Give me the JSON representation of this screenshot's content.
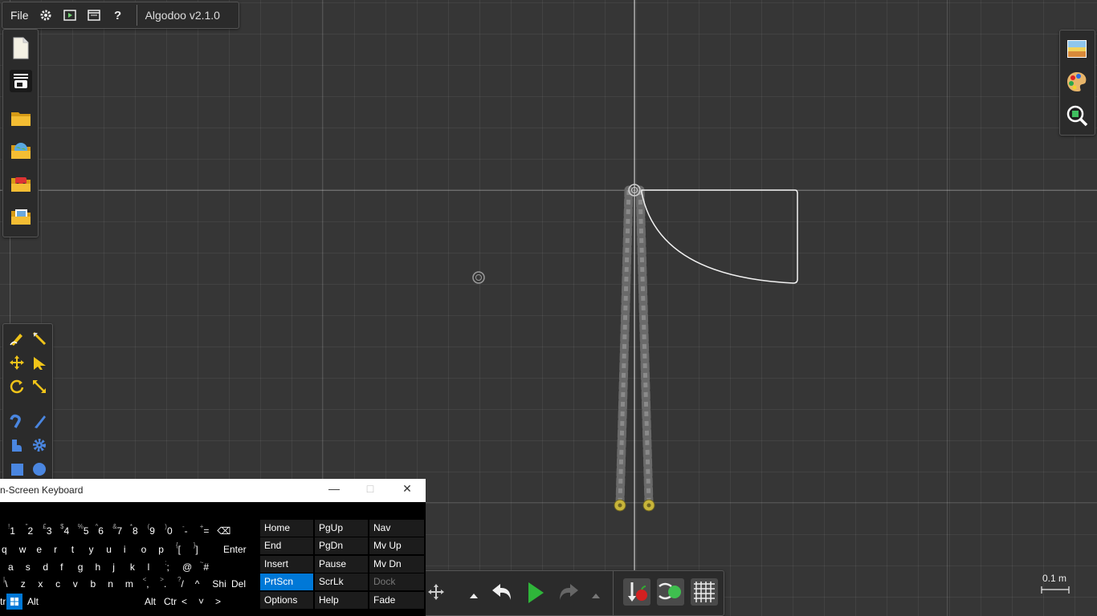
{
  "app": {
    "version": "Algodoo v2.1.0",
    "menu": {
      "file": "File"
    },
    "top_icons": [
      "settings-icon",
      "play-scene-icon",
      "window-icon",
      "help-icon"
    ]
  },
  "file_bar": [
    "new-scene-icon",
    "scene-list-icon",
    "open-folder-icon",
    "open-globe-icon",
    "open-phunlets-icon",
    "open-gallery-icon"
  ],
  "right_bar": [
    "background-icon",
    "palette-icon",
    "zoom-search-icon"
  ],
  "tools": [
    "sketch-tool-icon",
    "cut-tool-icon",
    "move-tool-icon",
    "drag-tool-icon",
    "rotate-tool-icon",
    "scale-tool-icon",
    "rope-tool-icon",
    "knife-tool-icon",
    "polygon-tool-icon",
    "gear-tool-icon",
    "box-tool-icon",
    "circle-tool-icon"
  ],
  "sim_controls": [
    "pan-icon",
    "expand-up-icon",
    "undo-icon",
    "play-icon",
    "redo-icon",
    "expand-up-icon",
    "gravity-icon",
    "air-friction-icon",
    "grid-icon"
  ],
  "scale_label": "0.1 m",
  "osk": {
    "title": "n-Screen Keyboard",
    "rows": [
      [
        {
          "k": "1",
          "s": "!"
        },
        {
          "k": "2",
          "s": "\""
        },
        {
          "k": "3",
          "s": "£"
        },
        {
          "k": "4",
          "s": "$"
        },
        {
          "k": "5",
          "s": "%"
        },
        {
          "k": "6",
          "s": "^"
        },
        {
          "k": "7",
          "s": "&"
        },
        {
          "k": "8",
          "s": "*"
        },
        {
          "k": "9",
          "s": "("
        },
        {
          "k": "0",
          "s": ")"
        },
        {
          "k": "-",
          "s": "-"
        },
        {
          "k": "=",
          "s": "+"
        },
        {
          "k": "⌫",
          "s": ""
        }
      ],
      [
        {
          "k": "q"
        },
        {
          "k": "w"
        },
        {
          "k": "e"
        },
        {
          "k": "r"
        },
        {
          "k": "t"
        },
        {
          "k": "y"
        },
        {
          "k": "u"
        },
        {
          "k": "i"
        },
        {
          "k": "o"
        },
        {
          "k": "p"
        },
        {
          "k": "[",
          "s": "{"
        },
        {
          "k": "]",
          "s": "}"
        },
        {
          "k": "Enter"
        }
      ],
      [
        {
          "k": "a"
        },
        {
          "k": "s"
        },
        {
          "k": "d"
        },
        {
          "k": "f"
        },
        {
          "k": "g"
        },
        {
          "k": "h"
        },
        {
          "k": "j"
        },
        {
          "k": "k"
        },
        {
          "k": "l"
        },
        {
          "k": ";",
          "s": ":"
        },
        {
          "k": "@",
          "s": ""
        },
        {
          "k": "#",
          "s": "~"
        }
      ],
      [
        {
          "k": "\\",
          "s": "|"
        },
        {
          "k": "z"
        },
        {
          "k": "x"
        },
        {
          "k": "c"
        },
        {
          "k": "v"
        },
        {
          "k": "b"
        },
        {
          "k": "n"
        },
        {
          "k": "m"
        },
        {
          "k": ",",
          "s": "<"
        },
        {
          "k": ".",
          "s": ">"
        },
        {
          "k": "/",
          "s": "?"
        },
        {
          "k": "^"
        },
        {
          "k": "Shi"
        },
        {
          "k": "Del"
        }
      ],
      [
        {
          "k": "tr"
        },
        {
          "k": "Alt"
        },
        {
          "k": "Alt"
        },
        {
          "k": "Ctr"
        },
        {
          "k": "<"
        },
        {
          "k": "˅"
        },
        {
          "k": ">"
        }
      ]
    ],
    "nav_keys": [
      [
        "Home",
        "PgUp",
        "Nav"
      ],
      [
        "End",
        "PgDn",
        "Mv Up"
      ],
      [
        "Insert",
        "Pause",
        "Mv Dn"
      ],
      [
        "PrtScn",
        "ScrLk",
        "Dock"
      ],
      [
        "Options",
        "Help",
        "Fade"
      ]
    ],
    "active_key": "PrtScn",
    "disabled_key": "Dock"
  }
}
